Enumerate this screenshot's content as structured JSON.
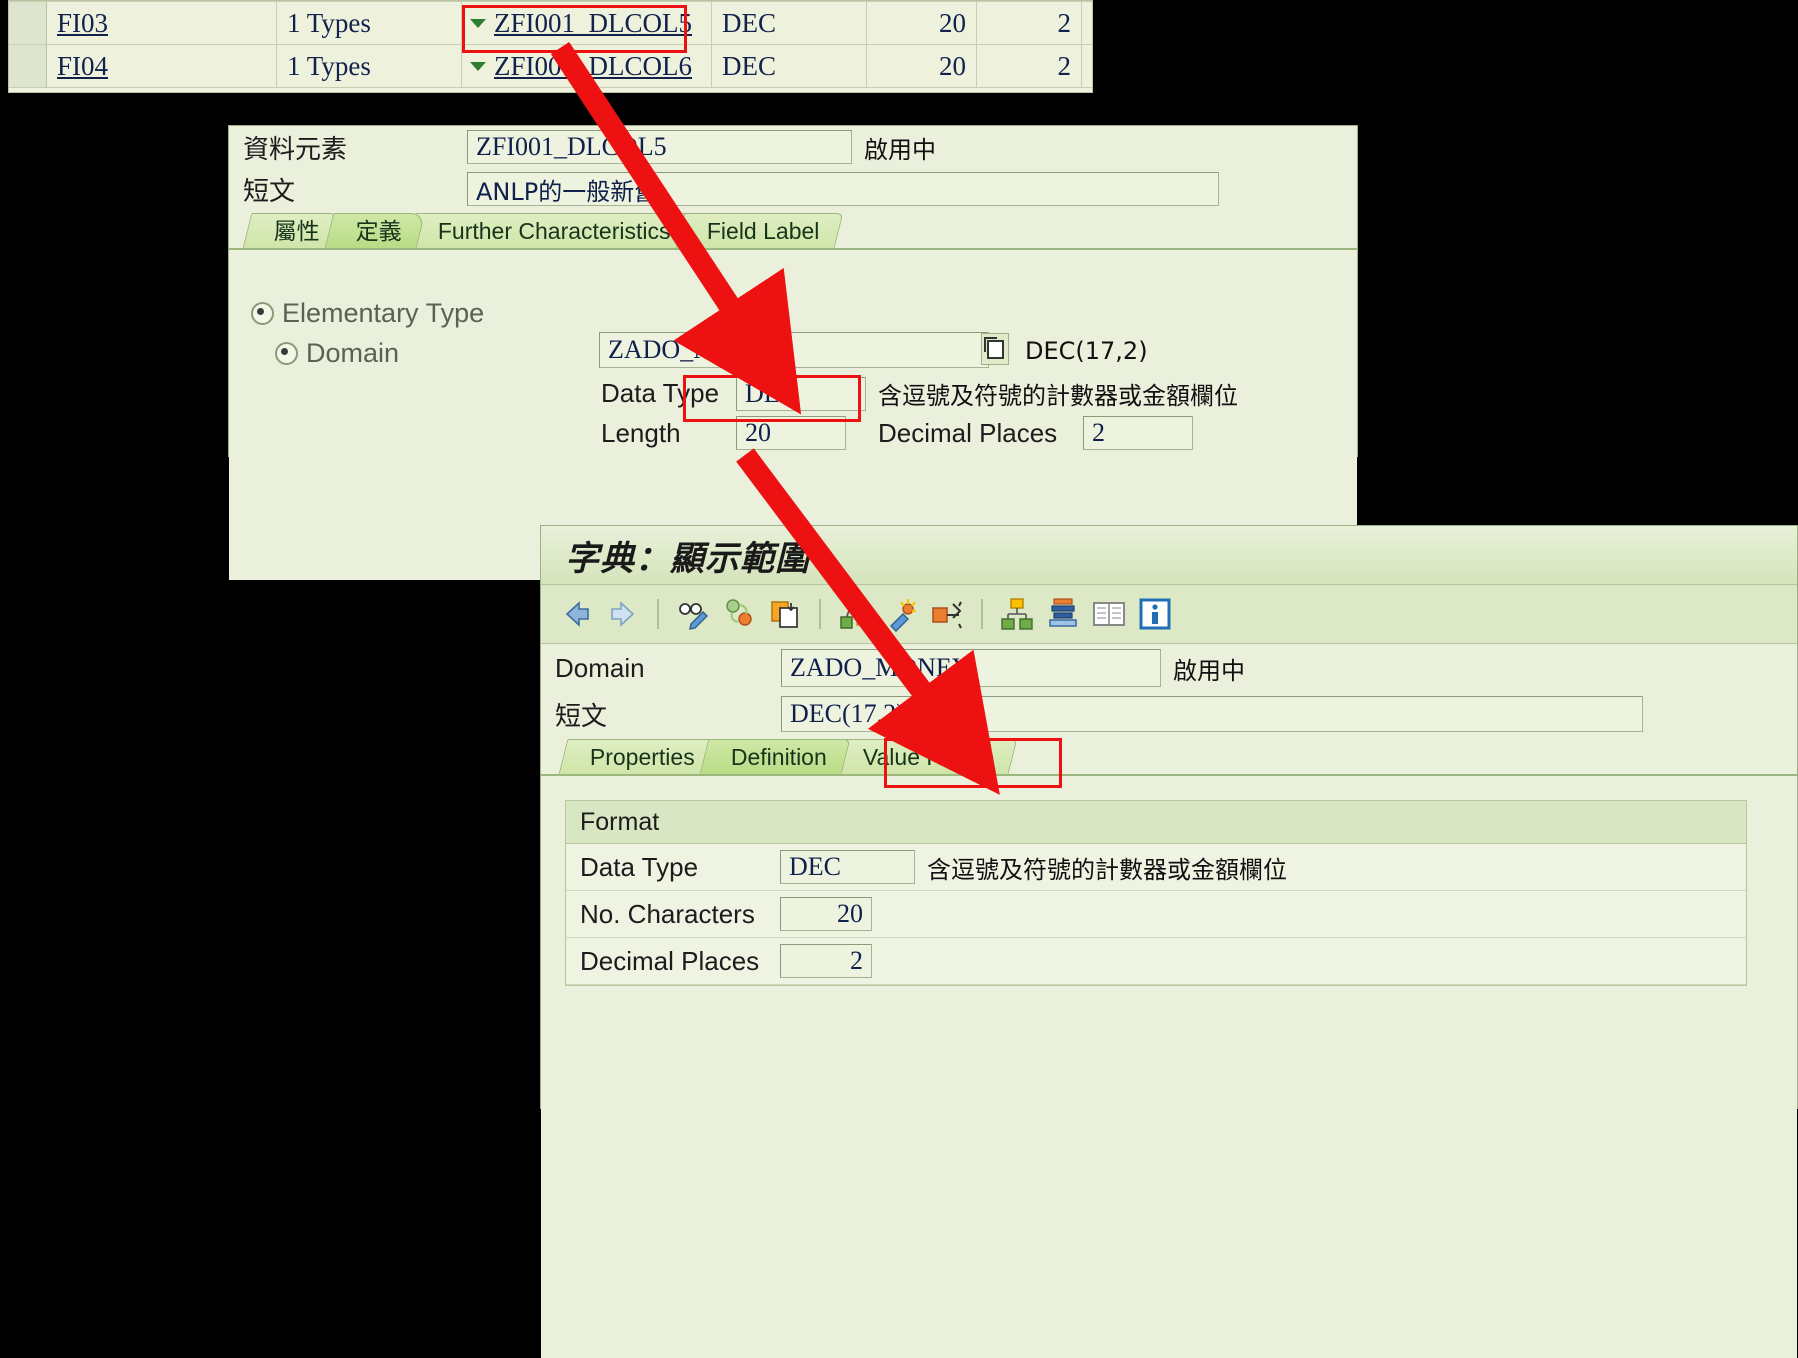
{
  "top_table": {
    "columns": [
      "field",
      "types",
      "data_element",
      "data_type",
      "length",
      "decimals"
    ],
    "rows": [
      {
        "field": "FI03",
        "types": "1  Types",
        "data_element": "ZFI001_DLCOL5",
        "data_type": "DEC",
        "length": "20",
        "decimals": "2"
      },
      {
        "field": "FI04",
        "types": "1  Types",
        "data_element": "ZFI001_DLCOL6",
        "data_type": "DEC",
        "length": "20",
        "decimals": "2"
      }
    ]
  },
  "data_element_panel": {
    "label_data_element": "資料元素",
    "value_data_element": "ZFI001_DLCOL5",
    "status": "啟用中",
    "label_short_text": "短文",
    "value_short_text": "ANLP的一般新舊",
    "tabs": [
      {
        "label": "屬性",
        "active": false
      },
      {
        "label": "定義",
        "active": true
      },
      {
        "label": "Further Characteristics",
        "active": false
      },
      {
        "label": "Field Label",
        "active": false
      }
    ],
    "elementary_type_label": "Elementary Type",
    "domain_label": "Domain",
    "domain_value": "ZADO_MONEY",
    "domain_type_hint": "DEC(17,2)",
    "data_type_label": "Data Type",
    "data_type_value": "DEC",
    "data_type_desc": "含逗號及符號的計數器或金額欄位",
    "length_label": "Length",
    "length_value": "20",
    "decimal_places_label": "Decimal Places",
    "decimal_places_value": "2"
  },
  "domain_panel": {
    "title": "字典：顯示範圍",
    "toolbar_icons": [
      "back-arrow-icon",
      "forward-arrow-icon",
      "display-change-icon",
      "activate-icon",
      "copy-icon",
      "where-used-list-icon",
      "generate-icon",
      "navigate-icon",
      "hierarchy-icon",
      "stack-icon",
      "documentation-icon",
      "info-icon"
    ],
    "label_domain": "Domain",
    "value_domain": "ZADO_MONEY",
    "status": "啟用中",
    "label_short_text": "短文",
    "value_short_text": "DEC(17,2)",
    "tabs": [
      {
        "label": "Properties",
        "active": false
      },
      {
        "label": "Definition",
        "active": true
      },
      {
        "label": "Value Range",
        "active": false
      }
    ],
    "format_group_title": "Format",
    "data_type_label": "Data Type",
    "data_type_value": "DEC",
    "data_type_desc": "含逗號及符號的計數器或金額欄位",
    "no_characters_label": "No. Characters",
    "no_characters_value": "20",
    "decimal_places_label": "Decimal Places",
    "decimal_places_value": "2"
  },
  "annotations": {
    "highlight_color": "#ee1111",
    "arrow_color": "#ee1111",
    "arrow_1_name": "arrow-from-data-element-to-domain",
    "arrow_2_name": "arrow-from-domain-field-to-domain-screen"
  }
}
